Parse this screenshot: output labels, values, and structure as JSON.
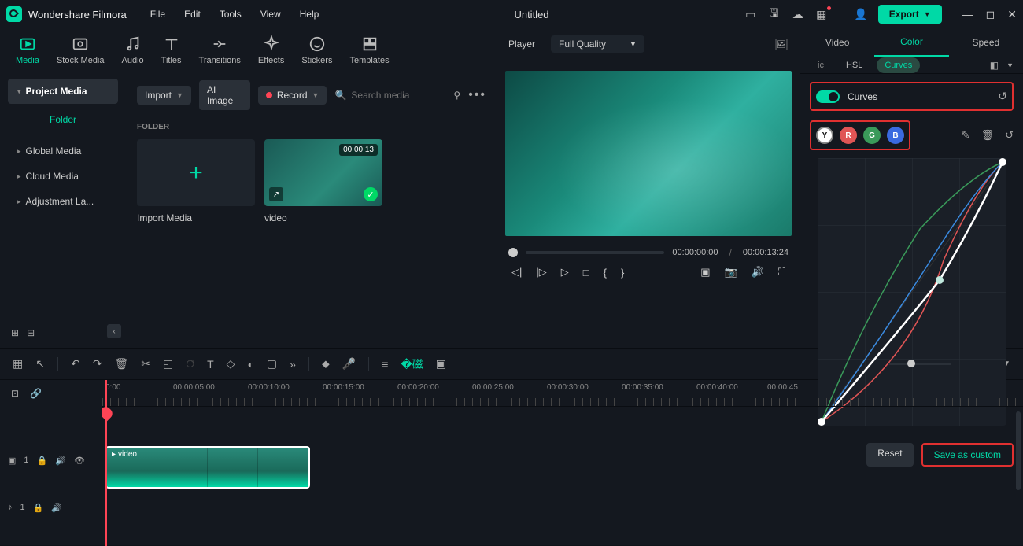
{
  "app": {
    "name": "Wondershare Filmora",
    "document": "Untitled"
  },
  "menu": [
    "File",
    "Edit",
    "Tools",
    "View",
    "Help"
  ],
  "export_label": "Export",
  "media_tabs": [
    {
      "label": "Media",
      "active": true
    },
    {
      "label": "Stock Media"
    },
    {
      "label": "Audio"
    },
    {
      "label": "Titles"
    },
    {
      "label": "Transitions"
    },
    {
      "label": "Effects"
    },
    {
      "label": "Stickers"
    },
    {
      "label": "Templates"
    }
  ],
  "sidebar": {
    "items": [
      {
        "label": "Project Media",
        "selected": true
      },
      {
        "label": "Folder",
        "folder": true
      },
      {
        "label": "Global Media"
      },
      {
        "label": "Cloud Media"
      },
      {
        "label": "Adjustment La..."
      }
    ]
  },
  "browser": {
    "import_label": "Import",
    "ai_label": "AI Image",
    "record_label": "Record",
    "search_placeholder": "Search media",
    "section": "FOLDER",
    "thumbs": [
      {
        "label": "Import Media",
        "type": "add"
      },
      {
        "label": "video",
        "type": "video",
        "duration": "00:00:13"
      }
    ]
  },
  "player": {
    "label": "Player",
    "quality": "Full Quality",
    "current": "00:00:00:00",
    "total": "00:00:13:24"
  },
  "props": {
    "tabs": [
      "Video",
      "Color",
      "Speed"
    ],
    "active_tab": "Color",
    "sub_tabs": {
      "ic": "ic",
      "hsl": "HSL",
      "curves": "Curves"
    },
    "curves_label": "Curves",
    "channels": [
      "Y",
      "R",
      "G",
      "B"
    ],
    "reset_label": "Reset",
    "save_label": "Save as custom"
  },
  "timeline": {
    "ruler": [
      "0:00",
      "00:00:05:00",
      "00:00:10:00",
      "00:00:15:00",
      "00:00:20:00",
      "00:00:25:00",
      "00:00:30:00",
      "00:00:35:00",
      "00:00:40:00",
      "00:00:45"
    ],
    "clip_label": "video",
    "tracks": [
      {
        "icon": "▣",
        "n": "1"
      },
      {
        "icon": "♪",
        "n": "1"
      }
    ]
  }
}
